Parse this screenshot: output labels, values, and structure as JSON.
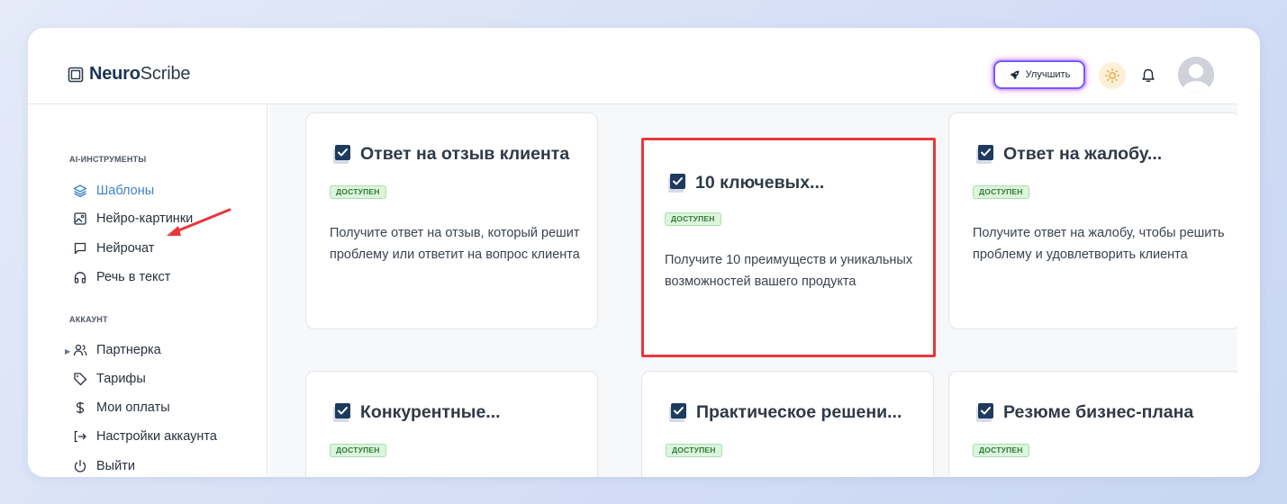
{
  "header": {
    "logo_bold": "Neuro",
    "logo_light": "Scribe",
    "upgrade_label": "Улучшить"
  },
  "sidebar": {
    "ai_section": "AI-ИНСТРУМЕНТЫ",
    "ai_items": [
      {
        "label": "Шаблоны",
        "icon": "layers-icon"
      },
      {
        "label": "Нейро-картинки",
        "icon": "image-icon"
      },
      {
        "label": "Нейрочат",
        "icon": "chat-icon"
      },
      {
        "label": "Речь в текст",
        "icon": "headphones-icon"
      }
    ],
    "account_section": "АККАУНТ",
    "account_items": [
      {
        "label": "Партнерка",
        "icon": "users-icon"
      },
      {
        "label": "Тарифы",
        "icon": "tag-icon"
      },
      {
        "label": "Мои оплаты",
        "icon": "dollar-icon"
      },
      {
        "label": "Настройки аккаунта",
        "icon": "logout-arrow-icon"
      },
      {
        "label": "Выйти",
        "icon": "power-icon"
      }
    ]
  },
  "cards": [
    {
      "title": "Ответ на отзыв клиента",
      "badge": "ДОСТУПЕН",
      "desc": "Получите ответ на отзыв, который решит проблему или ответит на вопрос клиента"
    },
    {
      "title": "10 ключевых...",
      "badge": "ДОСТУПЕН",
      "desc": "Получите 10 преимуществ и уникальных возможностей вашего продукта"
    },
    {
      "title": "Ответ на жалобу...",
      "badge": "ДОСТУПЕН",
      "desc": "Получите ответ на жалобу, чтобы решить проблему и удовлетворить клиента"
    },
    {
      "title": "Конкурентные...",
      "badge": "ДОСТУПЕН",
      "desc": ""
    },
    {
      "title": "Практическое решени...",
      "badge": "ДОСТУПЕН",
      "desc": ""
    },
    {
      "title": "Резюме бизнес-плана",
      "badge": "ДОСТУПЕН",
      "desc": ""
    }
  ],
  "colors": {
    "accent": "#3c83c8",
    "badge_bg": "#dcf5dd",
    "badge_text": "#2f7a36",
    "highlight_border": "#e8373a",
    "arrow": "#e8373a"
  }
}
